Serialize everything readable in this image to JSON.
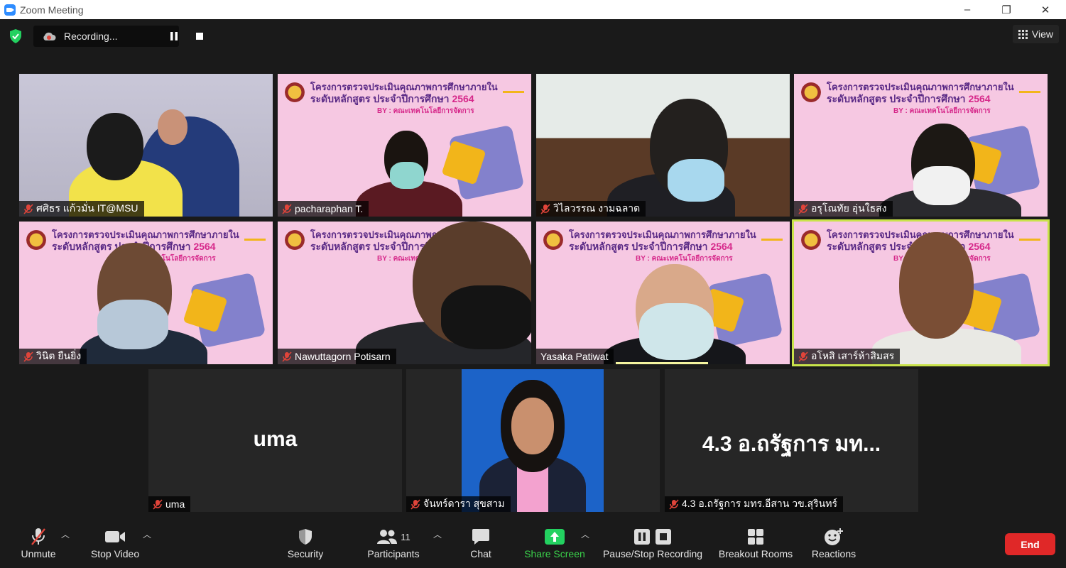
{
  "window": {
    "title": "Zoom Meeting",
    "minimize": "–",
    "restore": "❐",
    "close": "✕"
  },
  "topbar": {
    "recording_label": "Recording...",
    "view_label": "View"
  },
  "participants": [
    {
      "name": "ศศิธร แก้วมั่น IT@MSU"
    },
    {
      "name": "pacharaphan T."
    },
    {
      "name": "วิไลวรรณ งามฉลาด"
    },
    {
      "name": "อรุโณทัย อุ่นใธสง"
    },
    {
      "name": "วินิต ยืนยิ่ง"
    },
    {
      "name": "Nawuttagorn Potisarn"
    },
    {
      "name": "Yasaka Patiwat"
    },
    {
      "name": "อโหสิ เสาร์ห้าสิมสร"
    },
    {
      "name": "uma",
      "display": "uma"
    },
    {
      "name": "จันทร์ดารา สุขสาม"
    },
    {
      "name": "4.3 อ.ถรัฐการ มทร.อีสาน วข.สุรินทร์",
      "display": "4.3 อ.ถรัฐการ มท..."
    }
  ],
  "slide": {
    "line1": "โครงการตรวจประเมินคุณภาพการศึกษาภายใน",
    "line2": "ระดับหลักสูตร ประจำปีการศึกษา",
    "year": "2564",
    "line3": "BY : คณะเทคโนโลยีการจัดการ"
  },
  "toolbar": {
    "unmute": "Unmute",
    "stop_video": "Stop Video",
    "security": "Security",
    "participants": "Participants",
    "participants_count": "11",
    "chat": "Chat",
    "share_screen": "Share Screen",
    "pause_stop_recording": "Pause/Stop Recording",
    "breakout_rooms": "Breakout Rooms",
    "reactions": "Reactions",
    "end": "End"
  },
  "colors": {
    "share_green": "#3ad14a",
    "end_red": "#e02828",
    "active_speaker": "#c9e34a",
    "mute_red": "#e0443a"
  }
}
